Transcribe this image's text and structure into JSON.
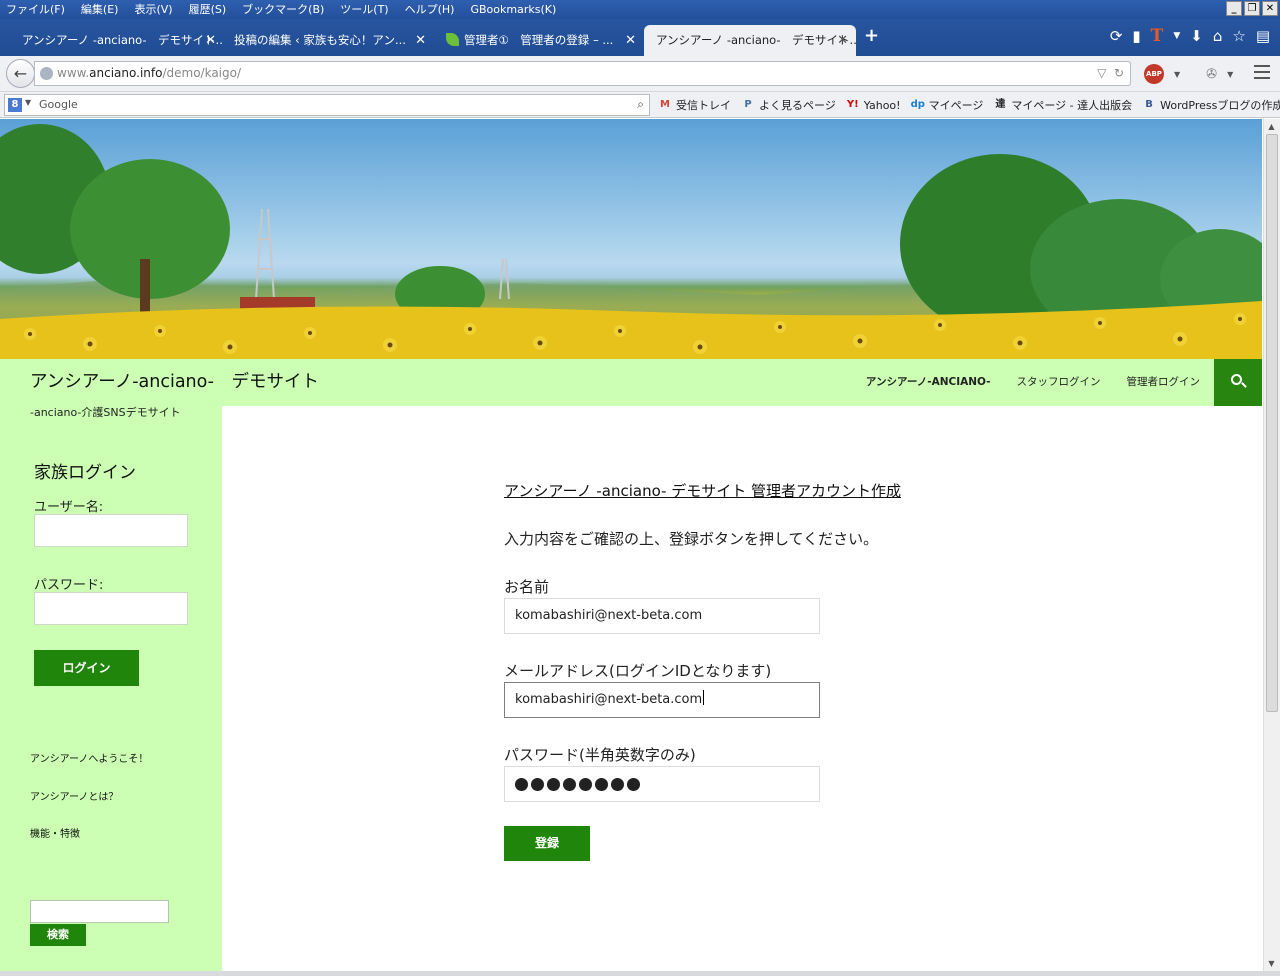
{
  "browser": {
    "menu": [
      "ファイル(F)",
      "編集(E)",
      "表示(V)",
      "履歴(S)",
      "ブックマーク(B)",
      "ツール(T)",
      "ヘルプ(H)",
      "GBookmarks(K)"
    ],
    "tabs": [
      {
        "label": "アンシアーノ -anciano-　デモサイト...",
        "active": false
      },
      {
        "label": "投稿の編集 ‹ 家族も安心！アン...",
        "active": false
      },
      {
        "label": "管理者①　管理者の登録 – ...",
        "active": false
      },
      {
        "label": "アンシアーノ -anciano-　デモサイト...",
        "active": true
      }
    ],
    "tab_close": "✕",
    "new_tab": "+",
    "url_prefix": "www.",
    "url_domain": "anciano.info",
    "url_path": "/demo/kaigo/",
    "search_placeholder": "Google",
    "bookmarks": [
      {
        "icon": "M",
        "label": "受信トレイ",
        "color": "#d44638"
      },
      {
        "icon": "P",
        "label": "よく見るページ",
        "color": "#4a6fa5"
      },
      {
        "icon": "Y!",
        "label": "Yahoo!",
        "color": "#d40000"
      },
      {
        "icon": "dp",
        "label": "マイページ",
        "color": "#1b7fd1"
      },
      {
        "icon": "達",
        "label": "マイページ - 達人出版会",
        "color": "#222222"
      },
      {
        "icon": "B",
        "label": "WordPressブログの作成...",
        "color": "#3b5998"
      }
    ]
  },
  "site": {
    "title": "アンシアーノ-anciano-　デモサイト",
    "tagline": "-anciano-介護SNSデモサイト",
    "nav": [
      "アンシアーノ-ANCIANO-",
      "スタッフログイン",
      "管理者ログイン"
    ],
    "accent_color": "#20850b",
    "header_bg": "#ccffb3"
  },
  "sidebar": {
    "login_title": "家族ログイン",
    "username_label": "ユーザー名:",
    "password_label": "パスワード:",
    "login_button": "ログイン",
    "links": [
      "アンシアーノへようこそ！",
      "アンシアーノとは？",
      "機能・特徴"
    ],
    "search_button": "検索"
  },
  "form": {
    "title": "アンシアーノ -anciano- デモサイト 管理者アカウント作成",
    "instruction": "入力内容をご確認の上、登録ボタンを押してください。",
    "name_label": "お名前",
    "name_value": "komabashiri@next-beta.com",
    "email_label": "メールアドレス(ログインIDとなります)",
    "email_value": "komabashiri@next-beta.com",
    "password_label": "パスワード(半角英数字のみ)",
    "password_mask_count": 8,
    "submit_button": "登録"
  }
}
